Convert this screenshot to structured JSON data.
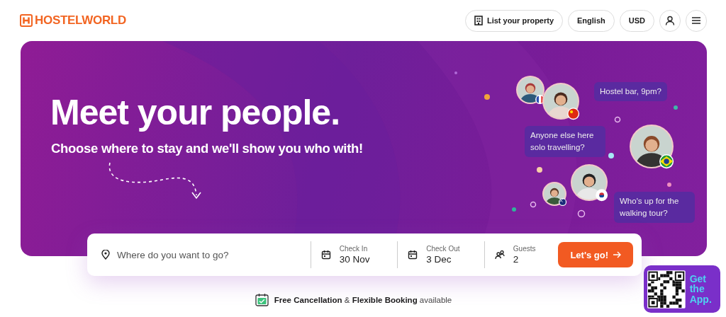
{
  "header": {
    "logo": "HOSTELWORLD",
    "buttons": [
      {
        "kind": "property",
        "label": "List your property"
      },
      {
        "kind": "text",
        "label": "English"
      },
      {
        "kind": "text",
        "label": "USD"
      },
      {
        "kind": "account"
      },
      {
        "kind": "menu"
      }
    ]
  },
  "hero": {
    "title": "Meet your people.",
    "subtitle": "Choose where to stay and we'll show you who with!",
    "bubbles": [
      "Hostel bar, 9pm?",
      "Anyone else here solo travelling?",
      "Who's up for the walking tour?"
    ]
  },
  "search": {
    "destination": {
      "placeholder": "Where do you want to go?"
    },
    "fields": [
      {
        "kind": "date",
        "label": "Check In",
        "value": "30 Nov"
      },
      {
        "kind": "date",
        "label": "Check Out",
        "value": "3 Dec"
      },
      {
        "kind": "guests",
        "label": "Guests",
        "value": "2"
      }
    ],
    "button": "Let's go!"
  },
  "note": "**Free Cancellation** & **Flexible Booking** available",
  "app_promo": "Get the App."
}
